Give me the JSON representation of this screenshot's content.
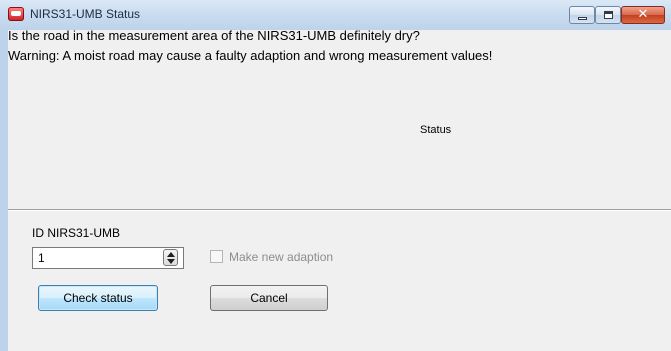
{
  "window": {
    "title": "NIRS31-UMB Status",
    "app_icon": "app-icon",
    "caption_buttons": {
      "minimize_icon": "minimize-icon",
      "maximize_icon": "maximize-icon",
      "close_glyph": "✕"
    }
  },
  "message": {
    "question": "Is the road in the measurement area of the NIRS31-UMB definitely dry?",
    "warning": "Warning: A moist road may cause a faulty adaption and wrong measurement values!"
  },
  "status": {
    "label": "Status"
  },
  "form": {
    "id_label": "ID NIRS31-UMB",
    "id_value": "1",
    "make_new_adaption": {
      "label": "Make new adaption",
      "checked": false,
      "enabled": false
    }
  },
  "buttons": {
    "check_status": "Check status",
    "cancel": "Cancel"
  },
  "colors": {
    "title_bar": "#c9dcf0",
    "client_bg": "#f0f0f0",
    "close_button": "#c4401f",
    "default_button_border": "#3c7fb1"
  }
}
